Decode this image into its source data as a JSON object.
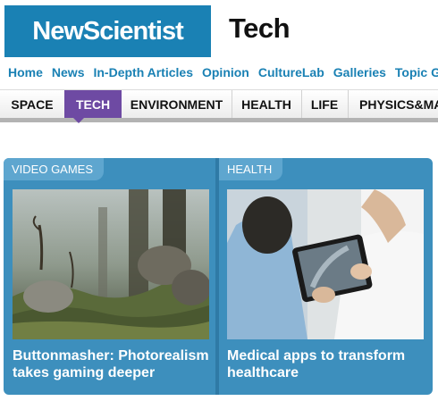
{
  "header": {
    "logo_text": "NewScientist",
    "section_title": "Tech"
  },
  "topnav": {
    "items": [
      "Home",
      "News",
      "In-Depth Articles",
      "Opinion",
      "CultureLab",
      "Galleries",
      "Topic Gui"
    ]
  },
  "categories": {
    "items": [
      "SPACE",
      "TECH",
      "ENVIRONMENT",
      "HEALTH",
      "LIFE",
      "PHYSICS&MAT"
    ],
    "active": "TECH"
  },
  "cards": [
    {
      "tag": "VIDEO GAMES",
      "title": "Buttonmasher: Photorealism takes gaming deeper",
      "image": "forest-game-scene"
    },
    {
      "tag": "HEALTH",
      "title": "Medical apps to transform healthcare",
      "image": "doctor-with-tablet"
    }
  ],
  "colors": {
    "brand_blue": "#1a81b4",
    "active_tab_purple": "#6e4aa3",
    "panel_blue": "#3d8fbd",
    "tag_blue": "#5ea6cf"
  }
}
